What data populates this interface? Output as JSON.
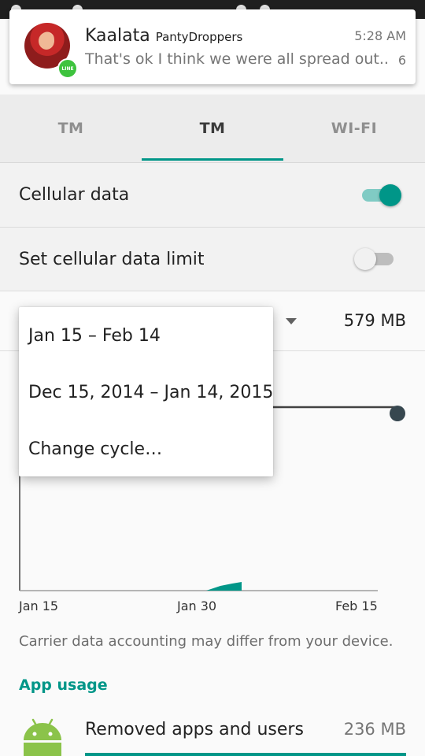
{
  "notification": {
    "sender": "Kaalata",
    "group": "PantyDroppers",
    "time": "5:28 AM",
    "message": "That's ok I think we were all spread out..",
    "count": "6"
  },
  "tabs": [
    {
      "label": "TM",
      "active": false
    },
    {
      "label": "TM",
      "active": true
    },
    {
      "label": "WI-FI",
      "active": false
    }
  ],
  "settings": {
    "cellular_data": {
      "label": "Cellular data",
      "enabled": true
    },
    "data_limit": {
      "label": "Set cellular data limit",
      "enabled": false
    }
  },
  "cycle": {
    "total": "579 MB",
    "options": [
      "Jan 15 – Feb 14",
      "Dec 15, 2014 – Jan 14, 2015",
      "Change cycle…"
    ]
  },
  "chart": {
    "x_labels": [
      "Jan 15",
      "Jan 30",
      "Feb 15"
    ]
  },
  "note": "Carrier data accounting may differ from your device.",
  "app_usage": {
    "header": "App usage",
    "items": [
      {
        "name": "Removed apps and users",
        "size": "236 MB",
        "icon": "android-icon"
      }
    ]
  },
  "colors": {
    "accent": "#009688"
  }
}
